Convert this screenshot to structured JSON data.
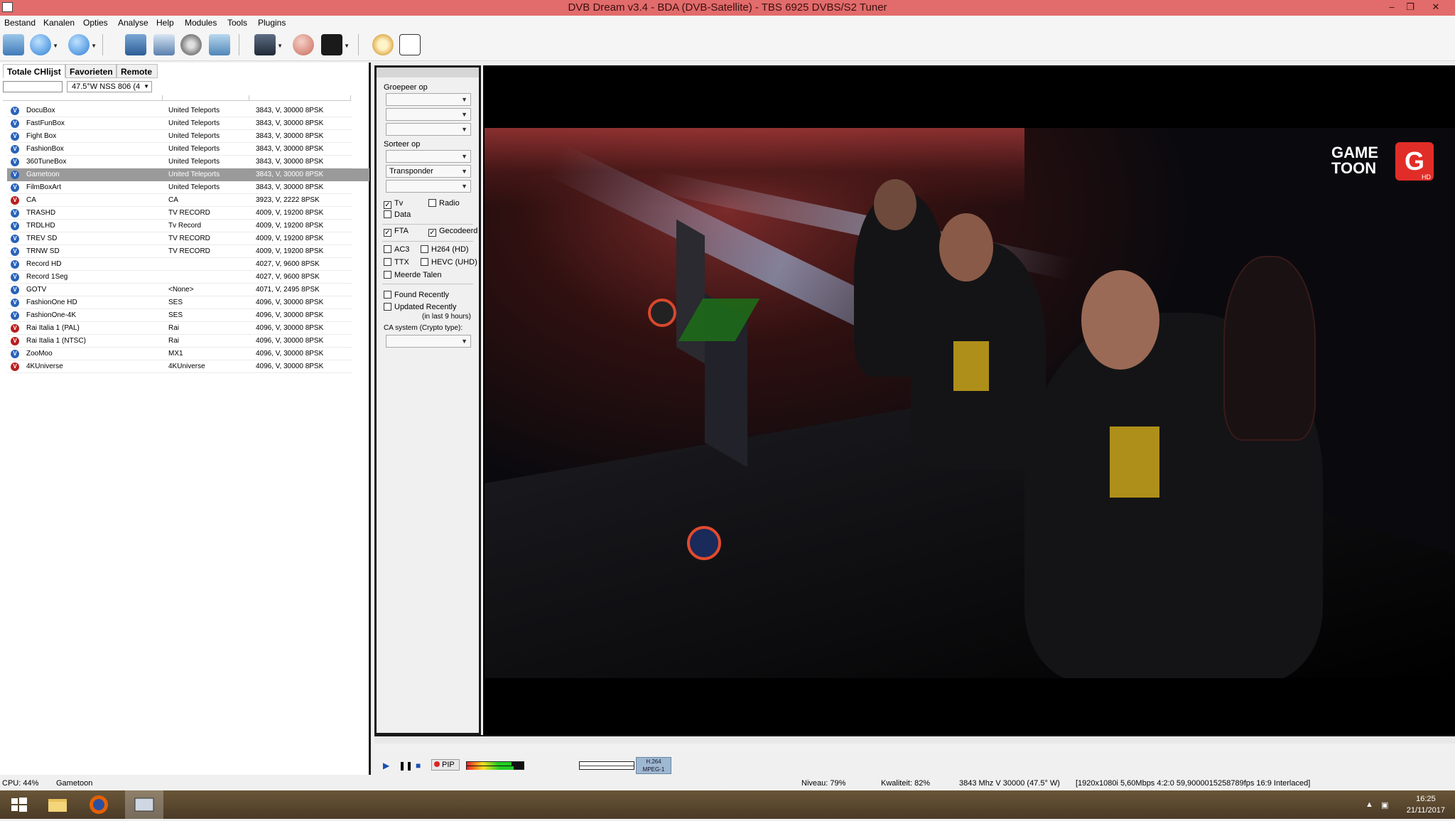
{
  "window": {
    "title": "DVB Dream v3.4  -  BDA (DVB-Satellite)  -  TBS 6925 DVBS/S2 Tuner",
    "controls": [
      "–",
      "❐",
      "✕"
    ]
  },
  "menu": [
    "Bestand",
    "Kanalen",
    "Opties",
    "Analyse",
    "Help",
    "Modules",
    "Tools",
    "Plugins"
  ],
  "toolbar": {
    "icons": [
      "open-icon",
      "back-icon",
      "forward-icon",
      "monitor-icon",
      "window-icon",
      "settings-gear-icon",
      "screen-icon",
      "clapper-icon",
      "stop-record-icon",
      "record-icon",
      "timer-icon",
      "epg-icon"
    ]
  },
  "channel_panel": {
    "tabs": [
      "Totale CHlijst",
      "Favorieten",
      "Remote"
    ],
    "search_value": "",
    "satellite": "47.5°W NSS 806 (4",
    "channels": [
      {
        "name": "DocuBox",
        "provider": "United Teleports",
        "transponder": "3843, V, 30000 8PSK",
        "scrambled": false
      },
      {
        "name": "FastFunBox",
        "provider": "United Teleports",
        "transponder": "3843, V, 30000 8PSK",
        "scrambled": false
      },
      {
        "name": "Fight Box",
        "provider": "United Teleports",
        "transponder": "3843, V, 30000 8PSK",
        "scrambled": false
      },
      {
        "name": "FashionBox",
        "provider": "United Teleports",
        "transponder": "3843, V, 30000 8PSK",
        "scrambled": false
      },
      {
        "name": "360TuneBox",
        "provider": "United Teleports",
        "transponder": "3843, V, 30000 8PSK",
        "scrambled": false
      },
      {
        "name": "Gametoon",
        "provider": "United Teleports",
        "transponder": "3843, V, 30000 8PSK",
        "scrambled": false,
        "selected": true
      },
      {
        "name": "FilmBoxArt",
        "provider": "United Teleports",
        "transponder": "3843, V, 30000 8PSK",
        "scrambled": false
      },
      {
        "name": "CA",
        "provider": "CA",
        "transponder": "3923, V, 2222 8PSK",
        "scrambled": true
      },
      {
        "name": "TRASHD",
        "provider": "TV RECORD",
        "transponder": "4009, V, 19200 8PSK",
        "scrambled": false
      },
      {
        "name": "TRDLHD",
        "provider": "Tv Record",
        "transponder": "4009, V, 19200 8PSK",
        "scrambled": false
      },
      {
        "name": "TREV SD",
        "provider": "TV RECORD",
        "transponder": "4009, V, 19200 8PSK",
        "scrambled": false
      },
      {
        "name": "TRNW SD",
        "provider": "TV RECORD",
        "transponder": "4009, V, 19200 8PSK",
        "scrambled": false
      },
      {
        "name": "Record HD",
        "provider": "",
        "transponder": "4027, V, 9600 8PSK",
        "scrambled": false
      },
      {
        "name": "Record 1Seg",
        "provider": "",
        "transponder": "4027, V, 9600 8PSK",
        "scrambled": false
      },
      {
        "name": "GOTV",
        "provider": "<None>",
        "transponder": "4071, V, 2495 8PSK",
        "scrambled": false
      },
      {
        "name": "FashionOne HD",
        "provider": "SES",
        "transponder": "4096, V, 30000 8PSK",
        "scrambled": false
      },
      {
        "name": "FashionOne-4K",
        "provider": "SES",
        "transponder": "4096, V, 30000 8PSK",
        "scrambled": false
      },
      {
        "name": "Rai Italia 1 (PAL)",
        "provider": "Rai",
        "transponder": "4096, V, 30000 8PSK",
        "scrambled": true
      },
      {
        "name": "Rai Italia 1 (NTSC)",
        "provider": "Rai",
        "transponder": "4096, V, 30000 8PSK",
        "scrambled": true
      },
      {
        "name": "ZooMoo",
        "provider": "MX1",
        "transponder": "4096, V, 30000 8PSK",
        "scrambled": false
      },
      {
        "name": "4KUniverse",
        "provider": "4KUniverse",
        "transponder": "4096, V, 30000 8PSK",
        "scrambled": true
      }
    ]
  },
  "filter_panel": {
    "group_label": "Groepeer op",
    "group_values": [
      "",
      "",
      ""
    ],
    "sort_label": "Sorteer op",
    "sort_values": [
      "",
      "Transponder",
      ""
    ],
    "checks": {
      "tv": {
        "label": "Tv",
        "checked": true
      },
      "radio": {
        "label": "Radio",
        "checked": false
      },
      "data": {
        "label": "Data",
        "checked": false
      },
      "fta": {
        "label": "FTA",
        "checked": true
      },
      "scrambled": {
        "label": "Gecodeerd",
        "checked": true
      },
      "ac3": {
        "label": "AC3",
        "checked": false
      },
      "h264": {
        "label": "H264 (HD)",
        "checked": false
      },
      "ttx": {
        "label": "TTX",
        "checked": false
      },
      "hevc": {
        "label": "HEVC (UHD)",
        "checked": false
      },
      "multilang": {
        "label": "Meerde Talen",
        "checked": false
      },
      "found_recently": {
        "label": "Found Recently",
        "checked": false
      },
      "updated_recently": {
        "label": "Updated Recently",
        "checked": false
      }
    },
    "updated_note": "(in last 9 hours)",
    "ca_label": "CA system (Crypto type):",
    "ca_value": ""
  },
  "video": {
    "logo_line1": "GAME",
    "logo_line2": "TOON",
    "logo_letter": "G",
    "logo_hd": "HD"
  },
  "playback": {
    "pip_label": "PIP",
    "codec_top": "H.264",
    "codec_bottom": "MPEG-1",
    "signal_level": 0.79,
    "signal_quality": 0.82
  },
  "status": {
    "cpu": "CPU: 44%",
    "channel": "Gametoon",
    "niveau": "Niveau: 79%",
    "kwaliteit": "Kwaliteit: 82%",
    "tuning": "3843 Mhz  V  30000  (47.5° W)",
    "stream": "[1920x1080i  5,60Mbps 4:2:0 59,9000015258789fps 16:9 Interlaced]"
  },
  "taskbar": {
    "time": "16:25",
    "date": "21/11/2017",
    "items": [
      "windows-start-icon",
      "file-explorer-icon",
      "firefox-icon",
      "dvbdream-icon"
    ]
  },
  "colors": {
    "titlebar": "#e26b6b",
    "selected_row": "#9a9a9a",
    "free_icon": "#2a63b8",
    "scrambled_icon": "#b81f1f",
    "logo_red": "#e12d28"
  }
}
